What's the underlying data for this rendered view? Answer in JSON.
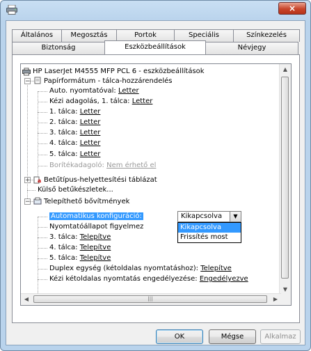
{
  "window": {
    "close_glyph": "×"
  },
  "tabs_top": [
    "Általános",
    "Megosztás",
    "Portok",
    "Speciális",
    "Színkezelés"
  ],
  "tabs_bottom": [
    "Biztonság",
    "Eszközbeállítások",
    "Névjegy"
  ],
  "active_tab": "Eszközbeállítások",
  "tree": {
    "root": "HP LaserJet M4555 MFP PCL 6 - eszközbeállítások",
    "paper": {
      "label": "Papírformátum - tálca-hozzárendelés",
      "items": [
        {
          "label": "Auto. nyomtatóval:",
          "value": "Letter",
          "disabled": false
        },
        {
          "label": "Kézi adagolás, 1. tálca:",
          "value": "Letter",
          "disabled": false
        },
        {
          "label": "1. tálca:",
          "value": "Letter",
          "disabled": false
        },
        {
          "label": "2. tálca:",
          "value": "Letter",
          "disabled": false
        },
        {
          "label": "3. tálca:",
          "value": "Letter",
          "disabled": false
        },
        {
          "label": "4. tálca:",
          "value": "Letter",
          "disabled": false
        },
        {
          "label": "5. tálca:",
          "value": "Letter",
          "disabled": false
        },
        {
          "label": "Borítékadagoló:",
          "value": "Nem érhető el",
          "disabled": true
        }
      ]
    },
    "font_table": "Betűtípus-helyettesítési táblázat",
    "external_fonts": "Külső betűkészletek...",
    "options": {
      "label": "Telepíthető bővítmények",
      "auto_config": {
        "label": "Automatikus konfiguráció:",
        "value": "Kikapcsolva"
      },
      "status_prefix": "Nyomtatóállapot figyelmez",
      "trays": [
        {
          "label": "3. tálca:",
          "value": "Telepítve"
        },
        {
          "label": "4. tálca:",
          "value": "Telepítve"
        },
        {
          "label": "5. tálca:",
          "value": "Telepítve"
        }
      ],
      "duplex": {
        "label": "Duplex egység (kétoldalas nyomtatáshoz):",
        "value": "Telepítve"
      },
      "manual_duplex": {
        "label": "Kézi kétoldalas nyomtatás engedélyezése:",
        "value": "Engedélyezve"
      }
    }
  },
  "dropdown_options": [
    "Kikapcsolva",
    "Frissítés most"
  ],
  "dropdown_highlighted": "Kikapcsolva",
  "buttons": {
    "ok": "OK",
    "cancel": "Mégse",
    "apply": "Alkalmaz"
  },
  "colors": {
    "selection": "#3399ff",
    "title_gradient_top": "#c9dff3",
    "close_red": "#c8452b"
  }
}
